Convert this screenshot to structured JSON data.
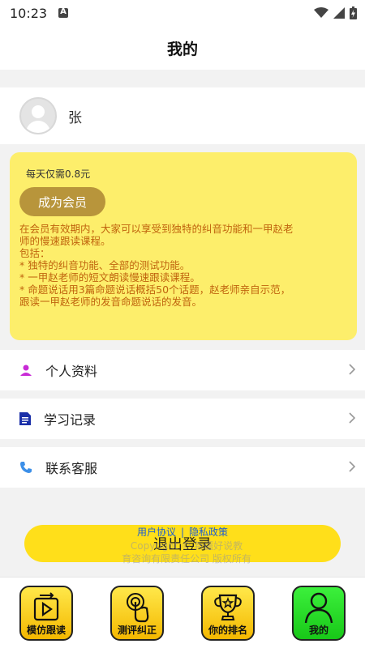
{
  "status": {
    "time": "10:23"
  },
  "header": {
    "title": "我的"
  },
  "profile": {
    "name": "张"
  },
  "membership": {
    "price": "每天仅需0.8元",
    "button_label": "成为会员",
    "desc_lines": [
      "在会员有效期内，大家可以享受到独特的纠音功能和一甲赵老",
      "师的慢速跟读课程。",
      "包括：",
      "* 独特的纠音功能、全部的测试功能。",
      "* 一甲赵老师的短文朗读慢速跟读课程。",
      "* 命题说话用3篇命题说话概括50个话题，赵老师亲自示范，",
      "跟读一甲赵老师的发音命题说话的发音。"
    ]
  },
  "menu": [
    {
      "label": "个人资料",
      "icon": "person-icon"
    },
    {
      "label": "学习记录",
      "icon": "document-icon"
    },
    {
      "label": "联系客服",
      "icon": "phone-icon"
    }
  ],
  "logout": {
    "label": "退出登录"
  },
  "links": {
    "agreement": "用户协议",
    "separator": "|",
    "privacy": "隐私政策"
  },
  "copyright": {
    "line1": "Copyright © 新疆好说教",
    "line2": "育咨询有限责任公司 版权所有"
  },
  "tabs": [
    {
      "label": "模仿跟读",
      "icon": "play-icon"
    },
    {
      "label": "测评纠正",
      "icon": "touch-icon"
    },
    {
      "label": "你的排名",
      "icon": "trophy-icon"
    },
    {
      "label": "我的",
      "icon": "user-icon",
      "active": true
    }
  ],
  "colors": {
    "member_card": "#fdee6b",
    "vip_button": "#b8953b",
    "desc_text": "#c0640e",
    "logout_button": "#ffdf1a",
    "link": "#1f5fd1",
    "tab_yellow": "#f4b800",
    "tab_active": "#18c818"
  }
}
